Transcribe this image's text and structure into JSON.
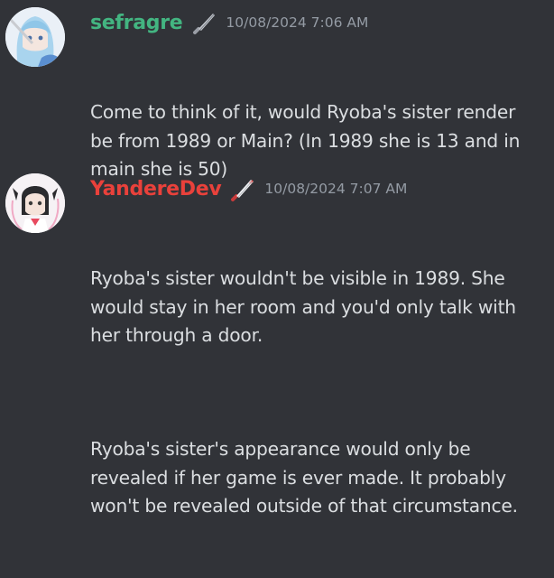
{
  "messages": [
    {
      "username": "sefragre",
      "username_color": "#43b581",
      "role_icon": "knife-icon",
      "timestamp": "10/08/2024 7:06 AM",
      "paragraphs": [
        "Come to think of it, would Ryoba's sister render be from 1989 or Main? (In 1989 she is 13 and in main she is 50)"
      ]
    },
    {
      "username": "YandereDev",
      "username_color": "#e9413b",
      "role_icon": "knife-icon",
      "timestamp": "10/08/2024 7:07 AM",
      "paragraphs": [
        "Ryoba's sister wouldn't be visible in 1989. She would stay in her room and you'd only talk with her through a door.",
        "Ryoba's sister's appearance would only be revealed if her game is ever made. It probably won't be revealed outside of that circumstance."
      ]
    }
  ],
  "colors": {
    "background": "#313338",
    "text": "#dbdee1",
    "timestamp": "#949ba4"
  }
}
